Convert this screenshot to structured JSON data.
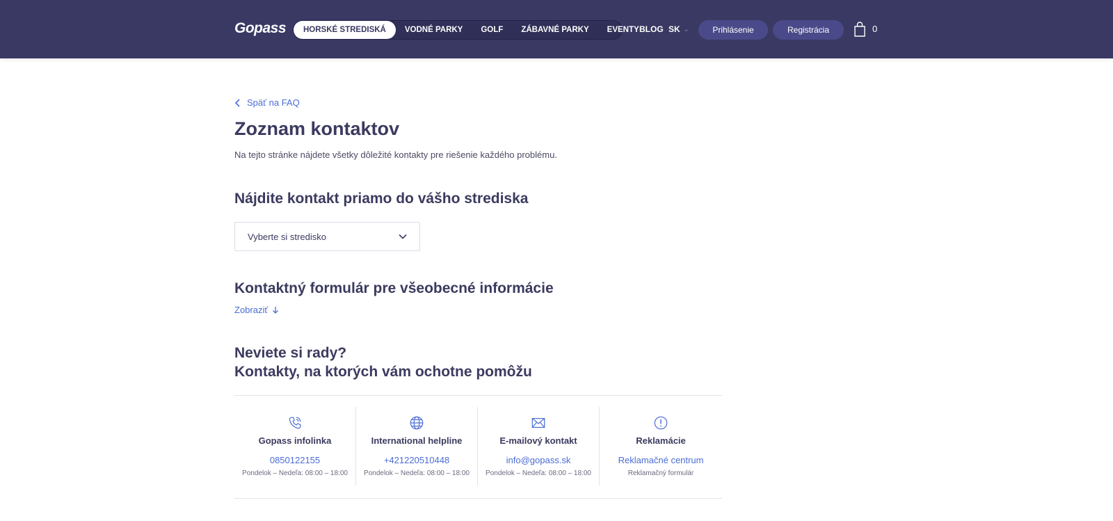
{
  "header": {
    "logo": "Gopass",
    "nav": [
      {
        "label": "HORSKÉ STREDISKÁ",
        "active": true
      },
      {
        "label": "VODNÉ PARKY",
        "active": false
      },
      {
        "label": "GOLF",
        "active": false
      },
      {
        "label": "ZÁBAVNÉ PARKY",
        "active": false
      },
      {
        "label": "EVENTY",
        "active": false
      }
    ],
    "blog": "BLOG",
    "language": "SK",
    "login": "Prihlásenie",
    "register": "Registrácia",
    "cart_count": "0"
  },
  "back_link": "Späť na FAQ",
  "title": "Zoznam kontaktov",
  "intro": "Na tejto stránke nájdete všetky dôležité kontakty pre riešenie každého problému.",
  "resort_section": {
    "heading": "Nájdite kontakt priamo do vášho strediska",
    "select_value": "Vyberte si stredisko"
  },
  "form_section": {
    "heading": "Kontaktný formulár pre všeobecné informácie",
    "show_label": "Zobraziť"
  },
  "help_section": {
    "heading_line1": "Neviete si rady?",
    "heading_line2": "Kontakty, na ktorých vám ochotne pomôžu"
  },
  "cards": [
    {
      "icon": "phone-icon",
      "title": "Gopass infolinka",
      "link": "0850122155",
      "sub": "Pondelok – Nedeľa: 08:00 – 18:00"
    },
    {
      "icon": "globe-icon",
      "title": "International helpline",
      "link": "+421220510448",
      "sub": "Pondelok – Nedeľa: 08:00 – 18:00"
    },
    {
      "icon": "mail-icon",
      "title": "E-mailový kontakt",
      "link": "info@gopass.sk",
      "sub": "Pondelok – Nedeľa: 08:00 – 18:00"
    },
    {
      "icon": "alert-icon",
      "title": "Reklamácie",
      "link": "Reklamačné centrum",
      "sub": "Reklamačný formulár"
    }
  ],
  "colors": {
    "header_bg": "#393963",
    "accent_link": "#4a6cd4",
    "heading": "#3b3a5f",
    "button_bg": "#4a4a8a"
  }
}
